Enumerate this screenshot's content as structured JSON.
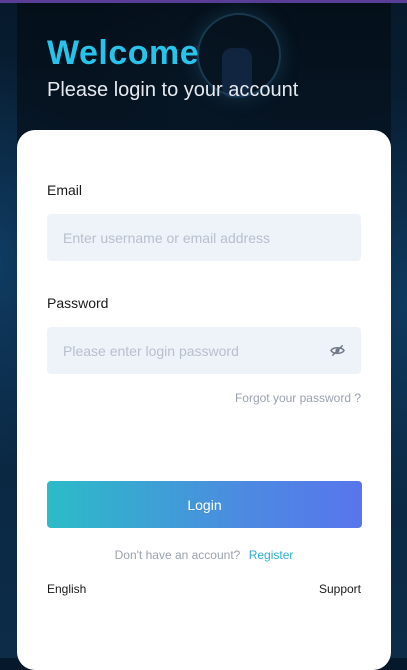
{
  "header": {
    "title": "Welcome",
    "subtitle": "Please login to your account"
  },
  "form": {
    "email": {
      "label": "Email",
      "placeholder": "Enter username or email address",
      "value": ""
    },
    "password": {
      "label": "Password",
      "placeholder": "Please enter login password",
      "value": "",
      "toggle_icon": "eye-slash-icon"
    },
    "forgot_link": "Forgot your password ?",
    "login_button": "Login"
  },
  "register": {
    "prompt": "Don't have an account?",
    "link": "Register"
  },
  "footer": {
    "language": "English",
    "support": "Support"
  },
  "colors": {
    "accent": "#27c3ea",
    "button_start": "#2bbcc7",
    "button_end": "#5875ec",
    "link": "#2bb0c8",
    "input_bg": "#eef2f9"
  }
}
